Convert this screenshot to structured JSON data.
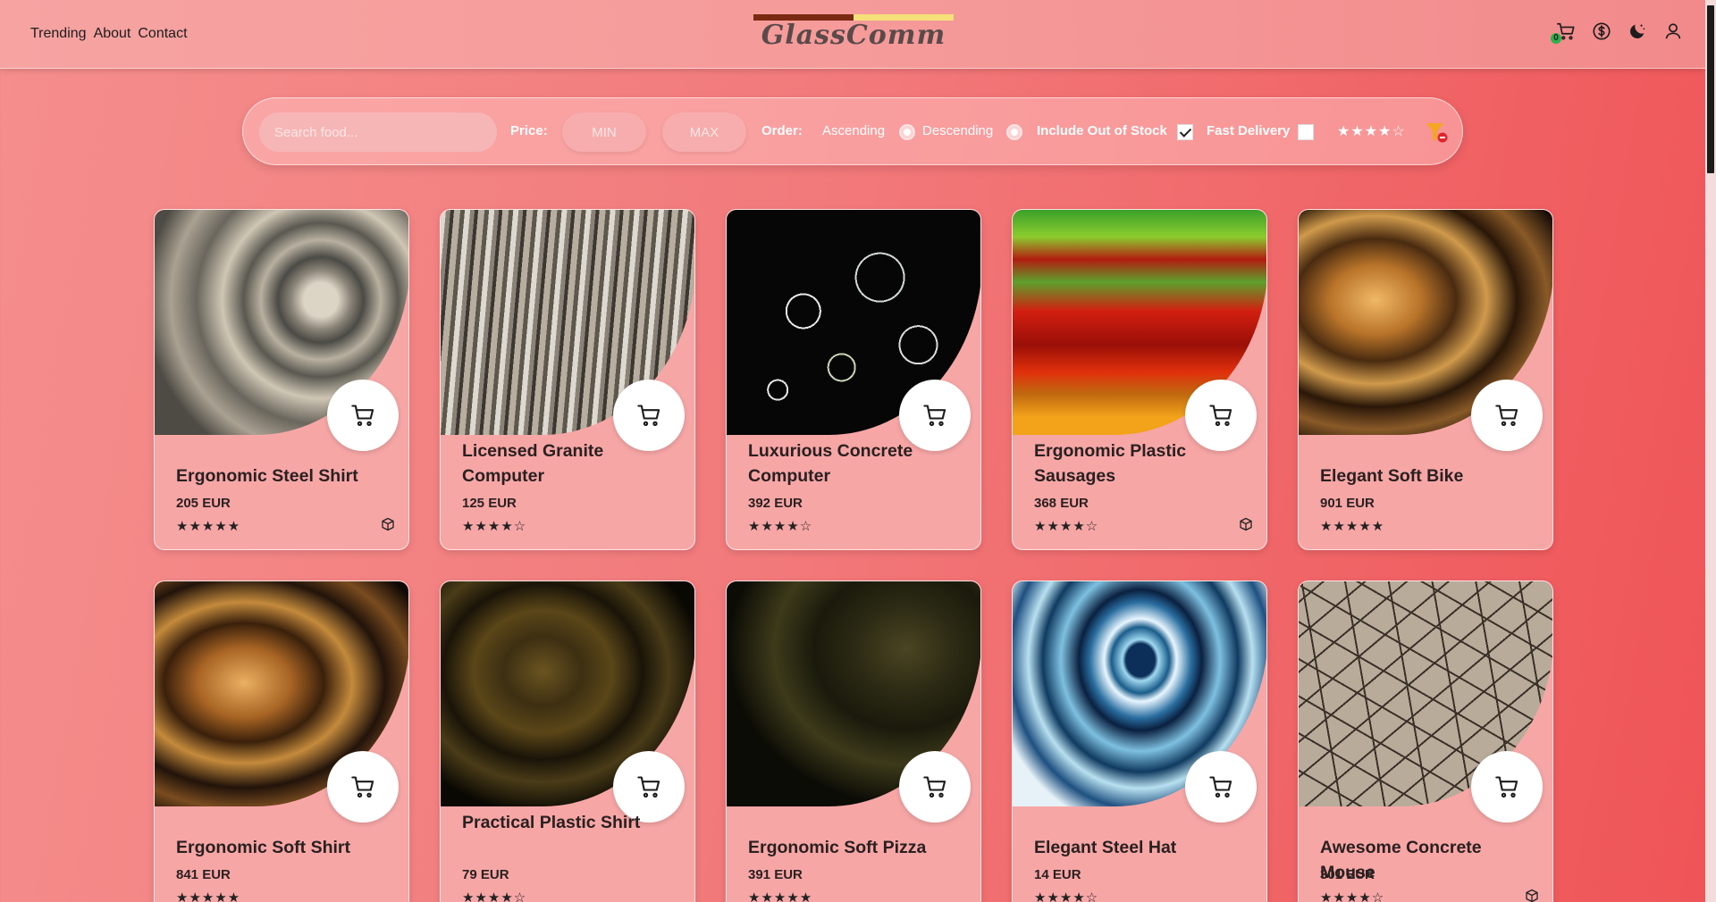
{
  "nav": {
    "links": [
      "Trending",
      "About",
      "Contact"
    ],
    "logo_text": "GlassComm",
    "cart_count": "0",
    "icons": [
      "cart-icon",
      "currency-icon",
      "dark-mode-icon",
      "user-icon"
    ]
  },
  "filters": {
    "search_placeholder": "Search food...",
    "price_label": "Price:",
    "min_placeholder": "MIN",
    "max_placeholder": "MAX",
    "order_label": "Order:",
    "ascending_label": "Ascending",
    "descending_label": "Descending",
    "out_of_stock_label": "Include Out of Stock",
    "out_of_stock_checked": true,
    "fast_delivery_label": "Fast Delivery",
    "fast_delivery_checked": false,
    "rating_filter": "★★★★☆",
    "rating_filter_value": 4
  },
  "colors": {
    "accent": "#f27a7b",
    "logo_bar_dark": "#7a2a12",
    "logo_bar_light": "#f5e07a",
    "cart_badge": "#2bb24c",
    "filter_reset_icon": "#f5a623"
  },
  "products": [
    {
      "name": "Ergonomic Steel Shirt",
      "price": "205 EUR",
      "stars": "★★★★★",
      "rating": 5,
      "box_icon": true,
      "image": "img-swirl"
    },
    {
      "name": "Licensed Granite Computer",
      "price": "125 EUR",
      "stars": "★★★★☆",
      "rating": 4,
      "box_icon": false,
      "image": "img-roots"
    },
    {
      "name": "Luxurious Concrete Computer",
      "price": "392 EUR",
      "stars": "★★★★☆",
      "rating": 4,
      "box_icon": false,
      "image": "img-crystal"
    },
    {
      "name": "Ergonomic Plastic Sausages",
      "price": "368 EUR",
      "stars": "★★★★☆",
      "rating": 4,
      "box_icon": true,
      "image": "img-lava"
    },
    {
      "name": "Elegant Soft Bike",
      "price": "901 EUR",
      "stars": "★★★★★",
      "rating": 5,
      "box_icon": false,
      "image": "img-amber"
    },
    {
      "name": "Ergonomic Soft Shirt",
      "price": "841 EUR",
      "stars": "★★★★★",
      "rating": 5,
      "box_icon": false,
      "image": "img-amber2"
    },
    {
      "name": "Practical Plastic Shirt",
      "price": "79 EUR",
      "stars": "★★★★☆",
      "rating": 4,
      "box_icon": false,
      "image": "img-dark"
    },
    {
      "name": "Ergonomic Soft Pizza",
      "price": "391 EUR",
      "stars": "★★★★★",
      "rating": 5,
      "box_icon": false,
      "image": "img-olive"
    },
    {
      "name": "Elegant Steel Hat",
      "price": "14 EUR",
      "stars": "★★★★☆",
      "rating": 4,
      "box_icon": false,
      "image": "img-fractal"
    },
    {
      "name": "Awesome Concrete Mouse",
      "price": "301 EUR",
      "stars": "★★★★☆",
      "rating": 4,
      "box_icon": true,
      "image": "img-mud"
    }
  ]
}
